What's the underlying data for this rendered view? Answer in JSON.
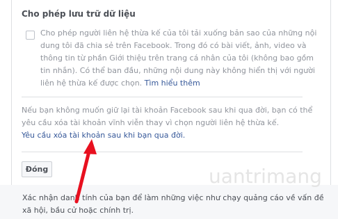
{
  "section": {
    "title": "Cho phép lưu trữ dữ liệu",
    "checkbox_text": "Cho phép người liên hệ thừa kế của tôi tải xuống bản sao của những nội dung tôi đã chia sẻ trên Facebook. Trong đó có bài viết, ảnh, video và thông tin từ phần Giới thiệu trên trang cá nhân của tôi (không bao gồm tin nhắn). Có thể ban đầu, những nội dung này không hiển thị với người liên hệ thừa kế được chọn.",
    "learn_more": "Tìm hiểu thêm",
    "checked": false
  },
  "delete": {
    "text": "Nếu bạn không muốn giữ lại tài khoản Facebook sau khi qua đời, bạn có thể yêu cầu xóa tài khoản vĩnh viễn thay vì chọn người liên hệ thừa kế.",
    "link": "Yêu cầu xóa tài khoản sau khi bạn qua đời."
  },
  "buttons": {
    "close": "Đóng"
  },
  "footer": {
    "text": "Xác nhận danh tính của bạn để làm những việc như chạy quảng cáo về vấn đề xã hội, bầu cử hoặc chính trị."
  },
  "watermark": {
    "text": "uantrimang"
  },
  "annotation": {
    "arrow_color": "#e8101f"
  },
  "colors": {
    "link": "#365899",
    "muted_text": "#90949c",
    "divider": "#dddfe2"
  }
}
